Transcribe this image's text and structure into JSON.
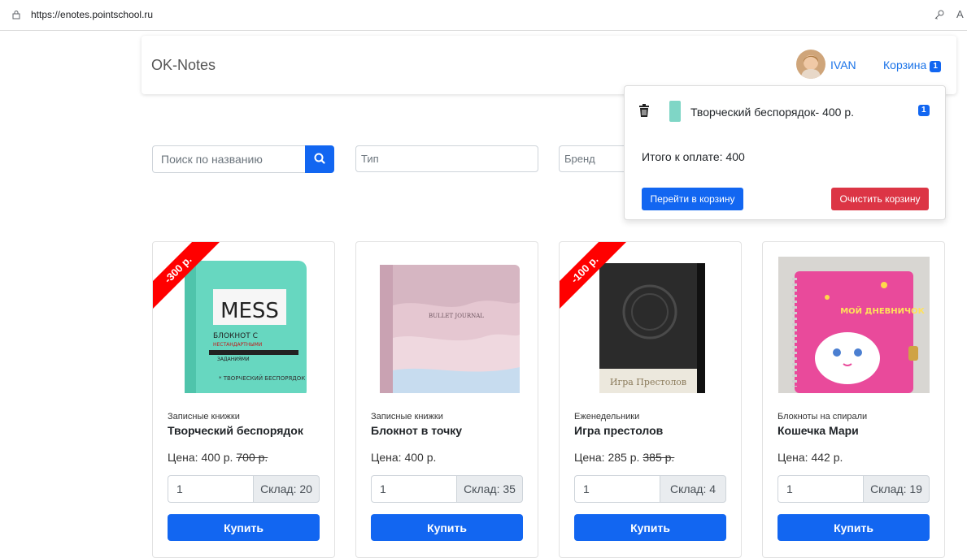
{
  "browser": {
    "url": "https://enotes.pointschool.ru",
    "reader_mode": "A"
  },
  "navbar": {
    "brand": "OK-Notes",
    "user": "IVAN",
    "cart_label": "Корзина",
    "cart_count": "1"
  },
  "filters": {
    "search_placeholder": "Поиск по названию",
    "type_label": "Тип",
    "brand_label": "Бренд"
  },
  "cart_dropdown": {
    "item_name": "Творческий беспорядок- 400 р.",
    "item_qty": "1",
    "total": "Итого к оплате: 400",
    "go_label": "Перейти в корзину",
    "clear_label": "Очистить корзину"
  },
  "products": [
    {
      "discount": "-300 р.",
      "category": "Записные книжки",
      "title": "Творческий беспорядок",
      "price": "Цена: 400 р.",
      "old_price": "700 р.",
      "qty": "1",
      "stock": "Склад: 20",
      "buy": "Купить"
    },
    {
      "discount": "",
      "category": "Записные книжки",
      "title": "Блокнот в точку",
      "price": "Цена: 400 р.",
      "old_price": "",
      "qty": "1",
      "stock": "Склад: 35",
      "buy": "Купить"
    },
    {
      "discount": "-100 р.",
      "category": "Еженедельники",
      "title": "Игра престолов",
      "price": "Цена: 285 р.",
      "old_price": "385 р.",
      "qty": "1",
      "stock": "Склад: 4",
      "buy": "Купить"
    },
    {
      "discount": "",
      "category": "Блокноты на спирали",
      "title": "Кошечка Мари",
      "price": "Цена: 442 р.",
      "old_price": "",
      "qty": "1",
      "stock": "Склад: 19",
      "buy": "Купить"
    }
  ],
  "cover_texts": {
    "mess_title": "MESS",
    "mess_line1": "БЛОКНОТ С",
    "mess_line2": "НЕСТАНДАРТНЫМИ",
    "mess_line3": "ЗАДАНИЯМИ",
    "mess_bottom": "* ТВОРЧЕСКИЙ БЕСПОРЯДОК",
    "bullet": "BULLET JOURNAL",
    "got": "Игра Престолов",
    "diary": "МОЙ ДНЕВНИЧОК"
  },
  "colors": {
    "accent": "#1266f1",
    "danger": "#dc3545",
    "ribbon": "#ff0000"
  }
}
